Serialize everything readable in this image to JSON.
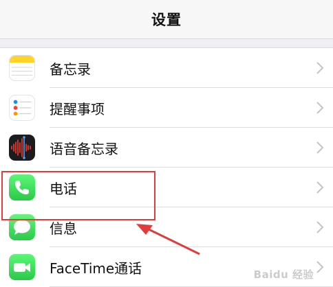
{
  "nav": {
    "title": "设置"
  },
  "rows": [
    {
      "label": "备忘录",
      "icon": "notes-icon"
    },
    {
      "label": "提醒事项",
      "icon": "reminders-icon"
    },
    {
      "label": "语音备忘录",
      "icon": "voice-memos-icon"
    },
    {
      "label": "电话",
      "icon": "phone-icon"
    },
    {
      "label": "信息",
      "icon": "messages-icon"
    },
    {
      "label": "FaceTime通话",
      "icon": "facetime-icon"
    }
  ],
  "annotation": {
    "highlight_color": "#e23b3b"
  },
  "watermark": "Baidu 经验"
}
